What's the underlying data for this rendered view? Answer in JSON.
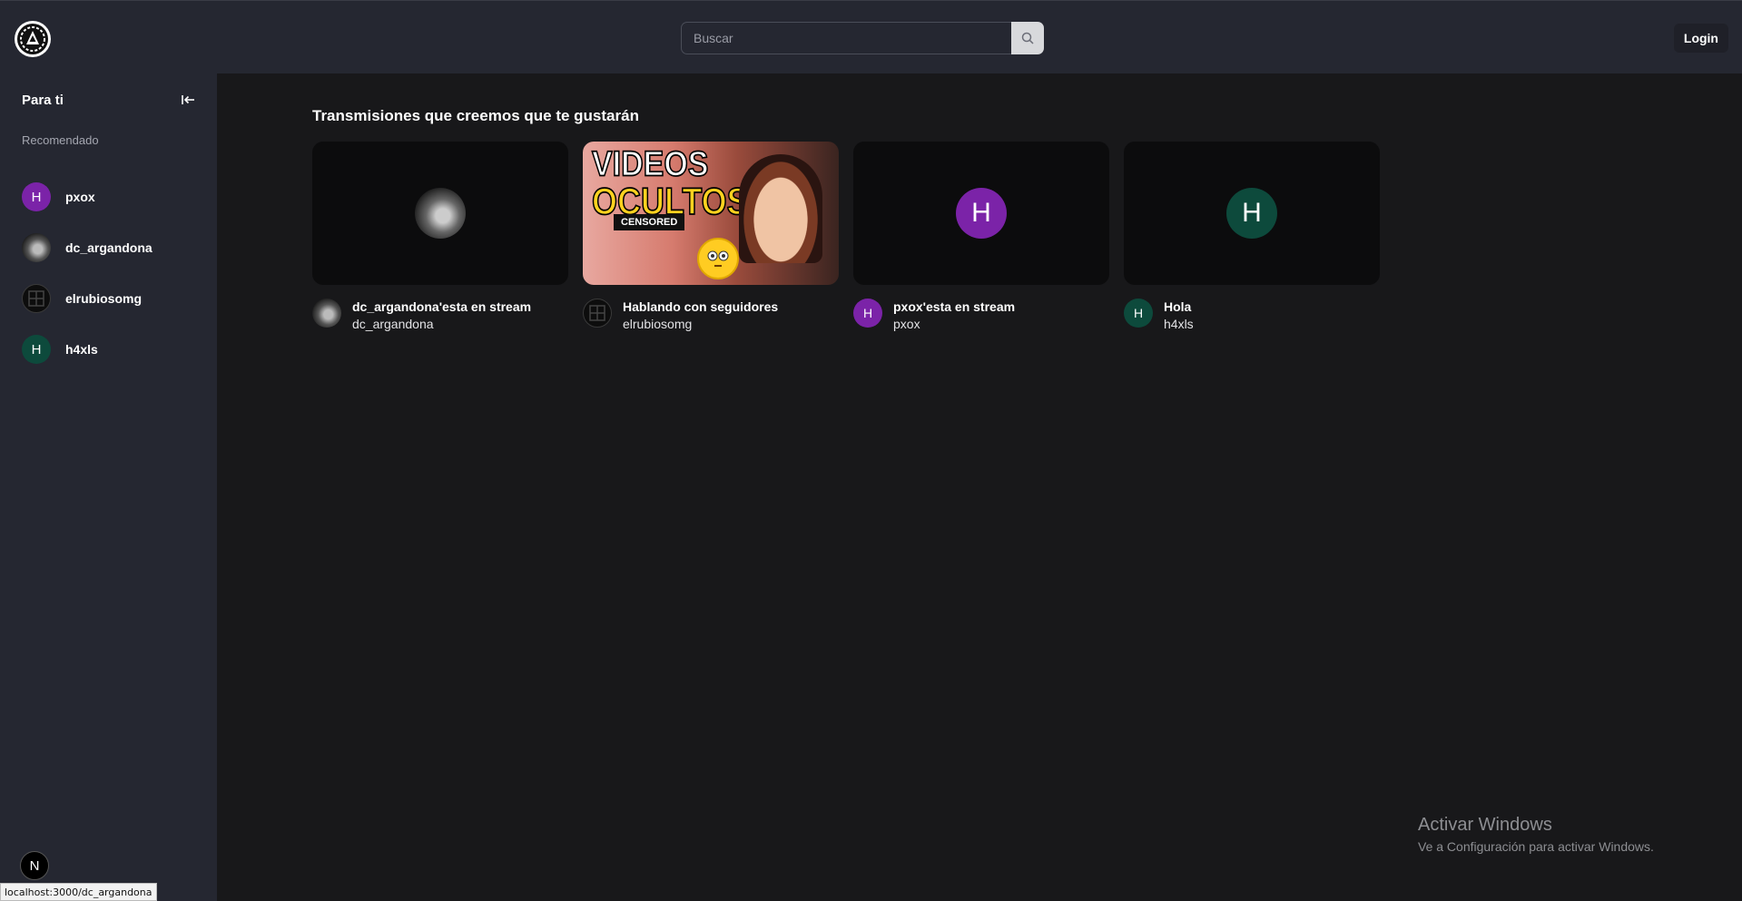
{
  "topbar": {
    "search": {
      "placeholder": "Buscar"
    },
    "login_label": "Login"
  },
  "sidebar": {
    "title": "Para ti",
    "section_label": "Recomendado",
    "items": [
      {
        "name": "pxox",
        "initial": "H",
        "color": "#7b23a8"
      },
      {
        "name": "dc_argandona",
        "initial": "",
        "color": "#2a2a2a"
      },
      {
        "name": "elrubiosomg",
        "initial": "",
        "color": "#0d0d0d"
      },
      {
        "name": "h4xls",
        "initial": "H",
        "color": "#0d4a3c"
      }
    ]
  },
  "main": {
    "heading": "Transmisiones que creemos que te gustarán",
    "cards": [
      {
        "title": "dc_argandona'esta en stream",
        "user": "dc_argandona",
        "initial": "",
        "color": "#2a2a2a"
      },
      {
        "title": "Hablando con seguidores",
        "user": "elrubiosomg",
        "initial": "",
        "color": "#0d0d0d",
        "thumb_text": {
          "line1": "VIDEOS",
          "line2": "OCULTOS",
          "badge": "CENSORED"
        }
      },
      {
        "title": "pxox'esta en stream",
        "user": "pxox",
        "initial": "H",
        "color": "#7b23a8"
      },
      {
        "title": "Hola",
        "user": "h4xls",
        "initial": "H",
        "color": "#0d4a3c"
      }
    ]
  },
  "status_bar_url": "localhost:3000/dc_argandona",
  "next_badge": "N",
  "watermark": {
    "title": "Activar Windows",
    "subtitle": "Ve a Configuración para activar Windows."
  }
}
